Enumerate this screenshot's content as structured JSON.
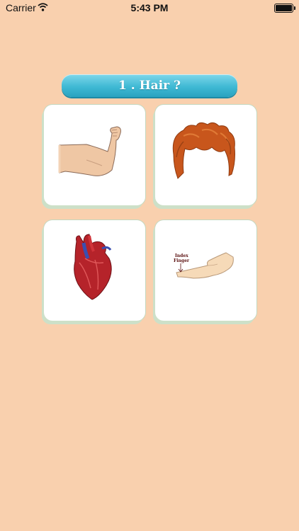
{
  "status_bar": {
    "carrier": "Carrier",
    "time": "5:43 PM",
    "battery_level": 1.0
  },
  "question": {
    "text": "1 . Hair ?"
  },
  "options": [
    {
      "name": "arm",
      "icon": "flexed-arm-image"
    },
    {
      "name": "hair",
      "icon": "hair-image"
    },
    {
      "name": "heart",
      "icon": "heart-image"
    },
    {
      "name": "index-finger",
      "icon": "hand-image",
      "label_line1": "Index",
      "label_line2": "Finger"
    }
  ],
  "colors": {
    "background": "#f9d0ae",
    "pill": "#3fb9d4",
    "card_shadow": "#cde0c8"
  }
}
